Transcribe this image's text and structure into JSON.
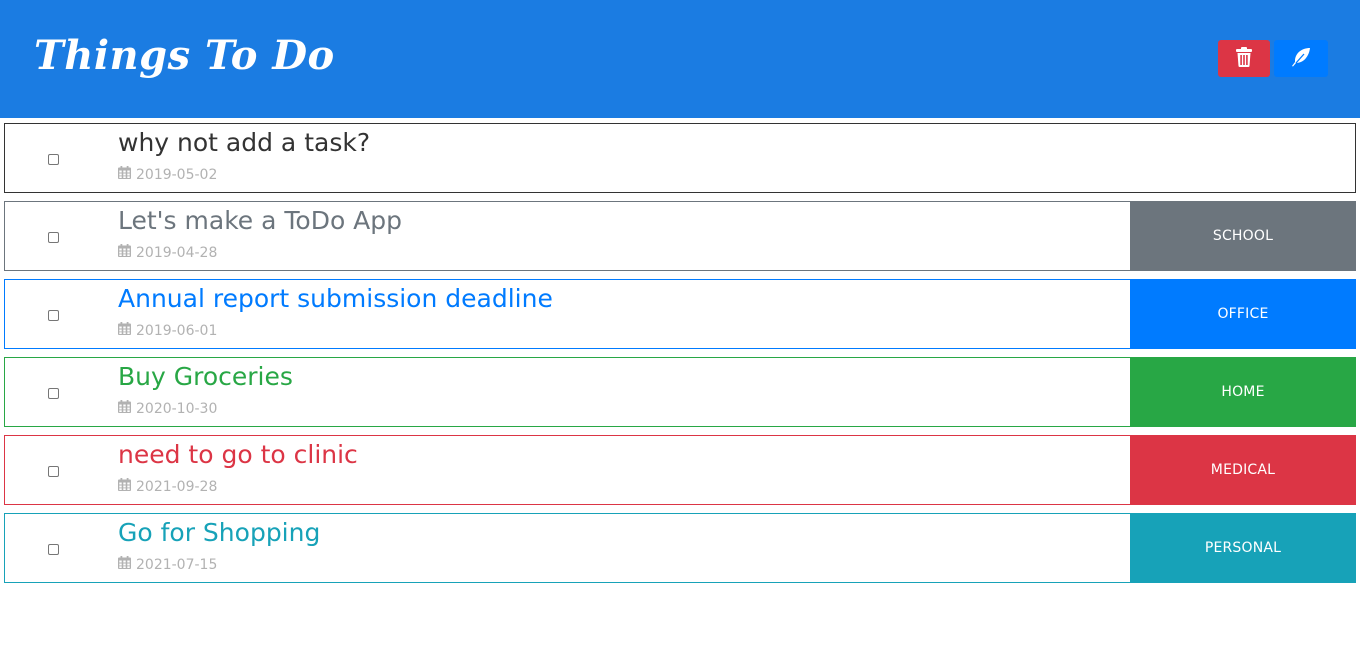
{
  "app": {
    "title": "Things To Do"
  },
  "header": {
    "delete_icon": "trash-icon",
    "add_icon": "feather-icon",
    "delete_color": "#dc3545",
    "add_color": "#007bff"
  },
  "todos": [
    {
      "title": "why not add a task?",
      "date": "2019-05-02",
      "tag": "",
      "color": "#333333",
      "border": "#333333"
    },
    {
      "title": "Let's make a ToDo App",
      "date": "2019-04-28",
      "tag": "SCHOOL",
      "color": "#6c757d",
      "border": "#6c757d"
    },
    {
      "title": "Annual report submission deadline",
      "date": "2019-06-01",
      "tag": "OFFICE",
      "color": "#007bff",
      "border": "#007bff"
    },
    {
      "title": "Buy Groceries",
      "date": "2020-10-30",
      "tag": "HOME",
      "color": "#28a745",
      "border": "#28a745"
    },
    {
      "title": "need to go to clinic",
      "date": "2021-09-28",
      "tag": "MEDICAL",
      "color": "#dc3545",
      "border": "#dc3545"
    },
    {
      "title": "Go for Shopping",
      "date": "2021-07-15",
      "tag": "PERSONAL",
      "color": "#17a2b8",
      "border": "#17a2b8"
    }
  ]
}
